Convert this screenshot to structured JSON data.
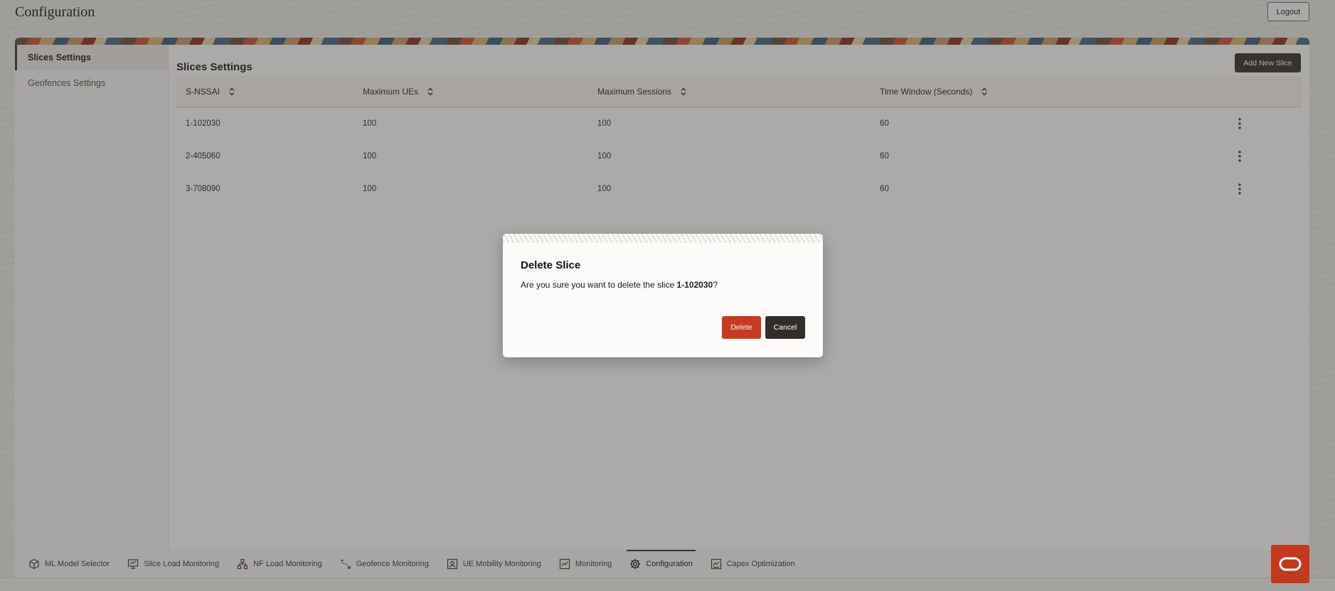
{
  "header": {
    "title": "Configuration",
    "logout_label": "Logout"
  },
  "sidebar": {
    "items": [
      {
        "label": "Slices Settings",
        "active": true
      },
      {
        "label": "Geofences Settings",
        "active": false
      }
    ]
  },
  "main": {
    "section_title": "Slices Settings",
    "add_button_label": "Add New Slice",
    "table": {
      "columns": [
        "S-NSSAI",
        "Maximum UEs",
        "Maximum Sessions",
        "Time Window (Seconds)"
      ],
      "rows": [
        [
          "1-102030",
          "100",
          "100",
          "60"
        ],
        [
          "2-405060",
          "100",
          "100",
          "60"
        ],
        [
          "3-708090",
          "100",
          "100",
          "60"
        ]
      ]
    }
  },
  "modal": {
    "title": "Delete Slice",
    "message_prefix": "Are you sure you want to delete the slice ",
    "message_target": "1-102030",
    "message_suffix": "?",
    "delete_label": "Delete",
    "cancel_label": "Cancel"
  },
  "bottom_nav": {
    "items": [
      {
        "label": "ML Model Selector",
        "icon": "cube-icon"
      },
      {
        "label": "Slice Load Monitoring",
        "icon": "monitor-icon"
      },
      {
        "label": "NF Load Monitoring",
        "icon": "network-icon"
      },
      {
        "label": "Geofence Monitoring",
        "icon": "route-icon"
      },
      {
        "label": "UE Mobility Monitoring",
        "icon": "user-frame-icon"
      },
      {
        "label": "Monitoring",
        "icon": "chart-icon"
      },
      {
        "label": "Configuration",
        "icon": "gear-icon",
        "active": true
      },
      {
        "label": "Capex Optimization",
        "icon": "chart-doc-icon"
      }
    ]
  },
  "colors": {
    "accent_dark": "#312d2a",
    "danger": "#c83a22",
    "brand_red": "#c2391f"
  }
}
